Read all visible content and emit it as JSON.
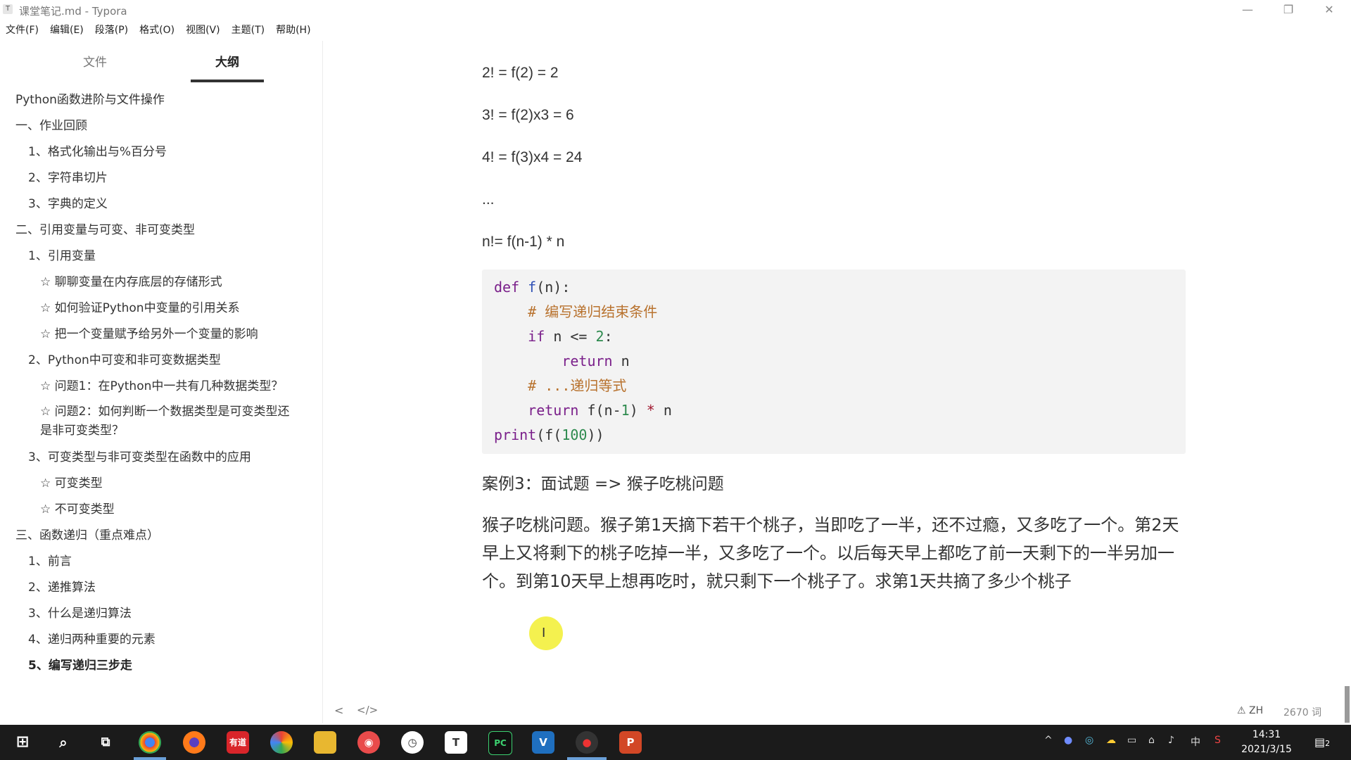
{
  "window": {
    "title": "课堂笔记.md - Typora",
    "app_icon": "T",
    "minimize_icon": "—",
    "maximize_icon": "❐",
    "close_icon": "✕"
  },
  "menu": [
    "文件(F)",
    "编辑(E)",
    "段落(P)",
    "格式(O)",
    "视图(V)",
    "主题(T)",
    "帮助(H)"
  ],
  "sidebar": {
    "tabs": {
      "files": "文件",
      "outline": "大纲"
    },
    "outline": [
      "Python函数进阶与文件操作",
      "一、作业回顾",
      "1、格式化输出与%百分号",
      "2、字符串切片",
      "3、字典的定义",
      "二、引用变量与可变、非可变类型",
      "1、引用变量",
      "☆ 聊聊变量在内存底层的存储形式",
      "☆ 如何验证Python中变量的引用关系",
      "☆ 把一个变量赋予给另外一个变量的影响",
      "2、Python中可变和非可变数据类型",
      "☆ 问题1：在Python中一共有几种数据类型？",
      "☆ 问题2：如何判断一个数据类型是可变类型还是非可变类型？",
      "3、可变类型与非可变类型在函数中的应用",
      "☆ 可变类型",
      "☆ 不可变类型",
      "三、函数递归（重点难点）",
      "1、前言",
      "2、递推算法",
      "3、什么是递归算法",
      "4、递归两种重要的元素",
      "5、编写递归三步走"
    ]
  },
  "editor": {
    "lines": [
      "2! = f(2) = 2",
      "3! = f(2)x3 = 6",
      "4! = f(3)x4 = 24",
      "...",
      "n!= f(n-1) * n"
    ],
    "code": {
      "def": "def",
      "fname": "f",
      "sig": "(n):",
      "comment1": "# 编写递归结束条件",
      "if": "if",
      "cond": "n <=",
      "two": "2",
      "colon": ":",
      "return": "return",
      "retval1": "n",
      "comment2": "# ...递归等式",
      "call": "f(n-",
      "one": "1",
      "close": ")",
      "star": "*",
      "n": "n",
      "print": "print",
      "print_open": "(f(",
      "hundred": "100",
      "print_close": "))"
    },
    "heading": "案例3：面试题 => 猴子吃桃问题",
    "body": "猴子吃桃问题。猴子第1天摘下若干个桃子，当即吃了一半，还不过瘾，又多吃了一个。第2天早上又将剩下的桃子吃掉一半，又多吃了一个。以后每天早上都吃了前一天剩下的一半另加一个。到第10天早上想再吃时，就只剩下一个桃子了。求第1天共摘了多少个桃子"
  },
  "statusbar": {
    "back": "<",
    "source_toggle": "</>",
    "language": "ZH",
    "words": "2670 词"
  },
  "taskbar": {
    "apps": [
      "有道",
      "T",
      "PC",
      "P"
    ],
    "tray": {
      "ime": "中",
      "time": "14:31",
      "date": "2021/3/15",
      "notifications": "2"
    }
  }
}
